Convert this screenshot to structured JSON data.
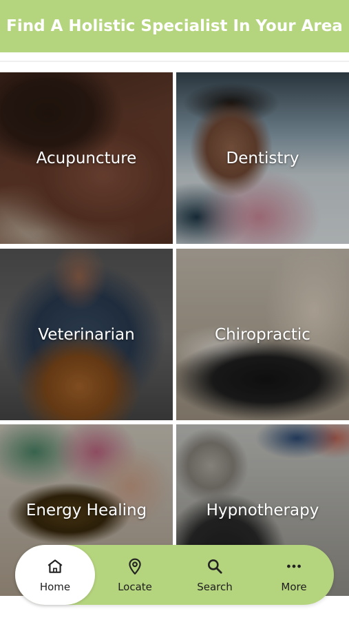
{
  "header": {
    "title": "Find A Holistic Specialist In Your Area",
    "background": "#b5d47e"
  },
  "specialties": [
    {
      "label": "Acupuncture"
    },
    {
      "label": "Dentistry"
    },
    {
      "label": "Veterinarian"
    },
    {
      "label": "Chiropractic"
    },
    {
      "label": "Energy Healing"
    },
    {
      "label": "Hypnotherapy"
    }
  ],
  "nav": {
    "items": [
      {
        "label": "Home",
        "icon": "home-icon",
        "active": true
      },
      {
        "label": "Locate",
        "icon": "location-pin-icon"
      },
      {
        "label": "Search",
        "icon": "search-icon"
      },
      {
        "label": "More",
        "icon": "more-dots-icon"
      }
    ],
    "background": "#b5d47e"
  }
}
